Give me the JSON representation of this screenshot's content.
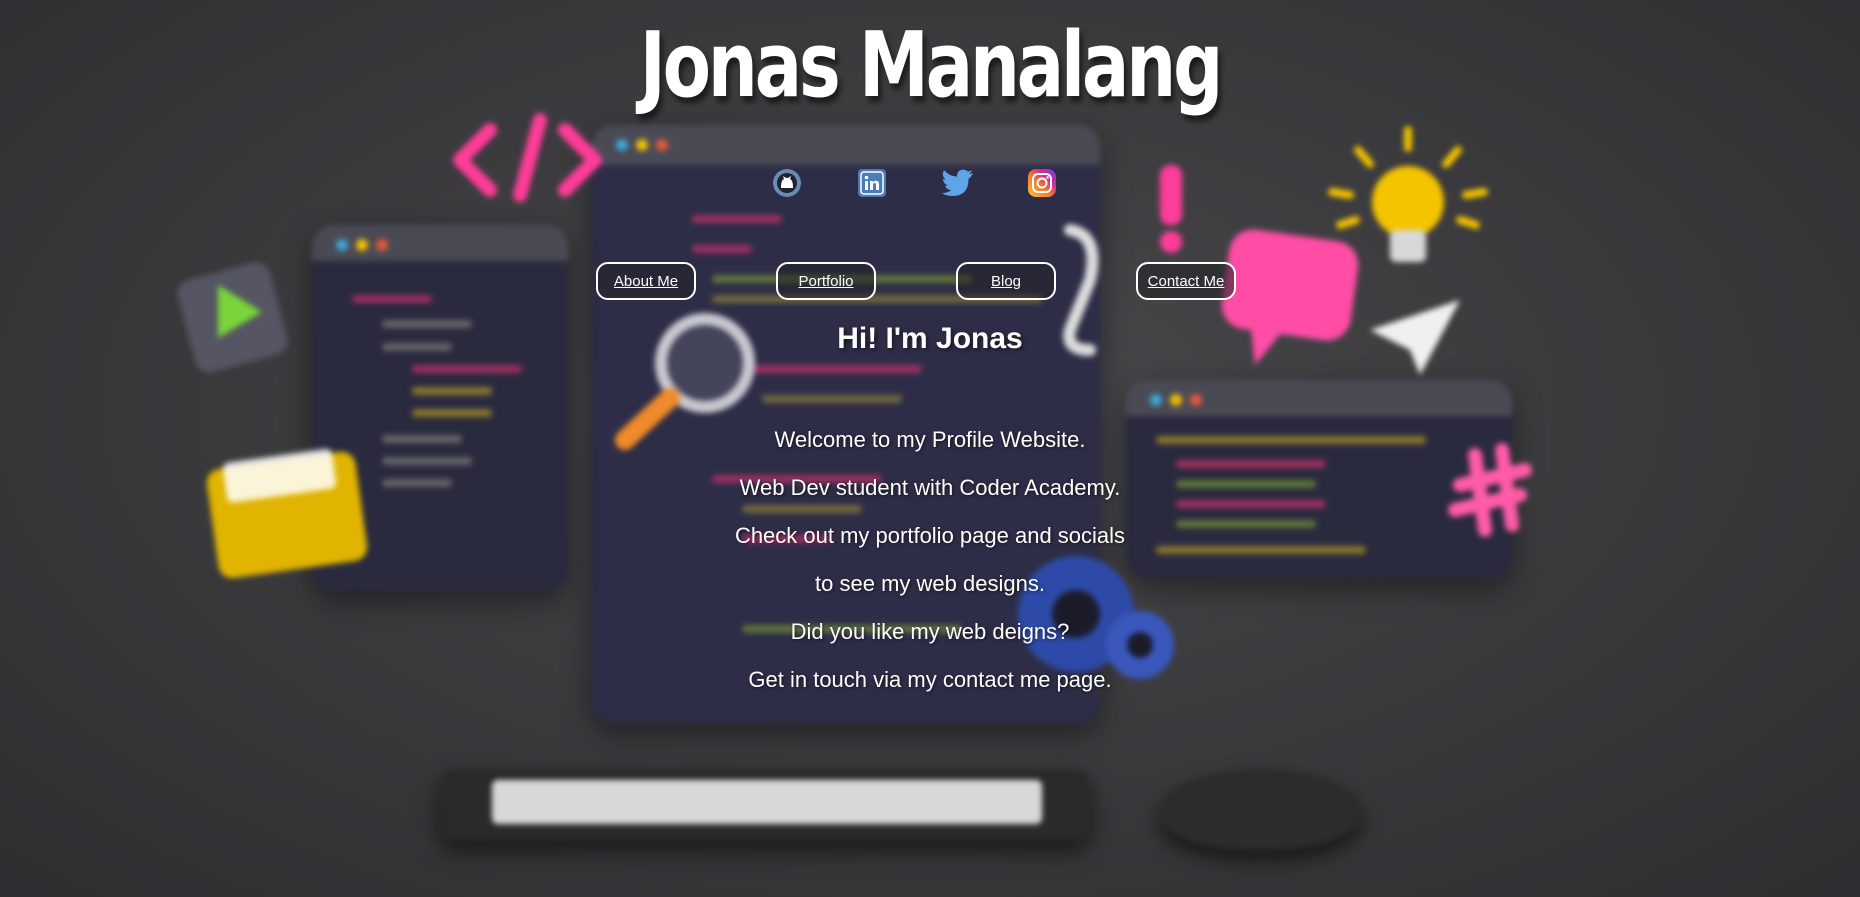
{
  "site": {
    "title": "Jonas Manalang"
  },
  "socials": [
    {
      "name": "GitHub",
      "icon": "github-icon",
      "color": "#6b8bb3"
    },
    {
      "name": "LinkedIn",
      "icon": "linkedin-icon",
      "color": "#4b7cb8"
    },
    {
      "name": "Twitter",
      "icon": "twitter-icon",
      "color": "#5ea4e6"
    },
    {
      "name": "Instagram",
      "icon": "instagram-icon",
      "color": "#d6249f"
    }
  ],
  "nav": {
    "about": "About Me",
    "portfolio": "Portfolio",
    "blog": "Blog",
    "contact": "Contact Me"
  },
  "main": {
    "greeting": "Hi! I'm Jonas",
    "lines": [
      "Welcome to my Profile Website.",
      "Web Dev student with Coder Academy.",
      "Check out my portfolio page and socials",
      "to see my web designs.",
      "Did you like my web deigns?",
      "Get in touch via my contact me page."
    ]
  },
  "colors": {
    "background": "#3a3a3c",
    "text": "#ffffff",
    "button_border": "#ffffff",
    "accent_pink": "#ff3d9a",
    "accent_yellow": "#f5c400"
  }
}
